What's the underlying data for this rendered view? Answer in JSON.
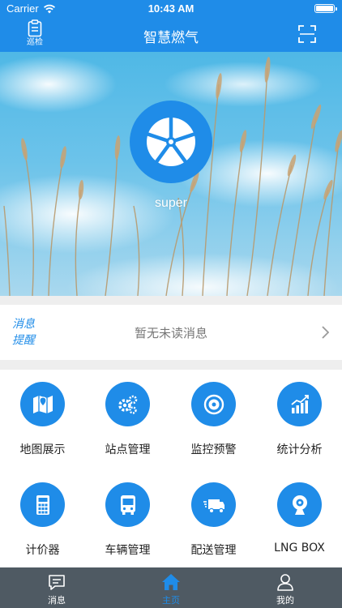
{
  "status_bar": {
    "carrier": "Carrier",
    "time": "10:43 AM"
  },
  "nav": {
    "left_label": "巡检",
    "title": "智慧燃气",
    "left_icon": "clipboard-icon",
    "right_icon": "scan-icon"
  },
  "profile": {
    "username": "super"
  },
  "message": {
    "label_line1": "消息",
    "label_line2": "提醒",
    "text": "暂无未读消息"
  },
  "grid": [
    {
      "label": "地图展示",
      "icon": "map-icon"
    },
    {
      "label": "站点管理",
      "icon": "gears-icon"
    },
    {
      "label": "监控预警",
      "icon": "alarm-icon"
    },
    {
      "label": "统计分析",
      "icon": "chart-icon"
    },
    {
      "label": "计价器",
      "icon": "calculator-icon"
    },
    {
      "label": "车辆管理",
      "icon": "bus-icon"
    },
    {
      "label": "配送管理",
      "icon": "truck-icon"
    },
    {
      "label": "LNG BOX",
      "icon": "webcam-icon"
    }
  ],
  "tabs": [
    {
      "label": "消息",
      "icon": "chat-icon"
    },
    {
      "label": "主页",
      "icon": "home-icon",
      "active": true
    },
    {
      "label": "我的",
      "icon": "user-icon"
    }
  ],
  "colors": {
    "primary": "#1f8ce8",
    "tabbar": "#4f5a63",
    "background": "#eeeeee"
  }
}
